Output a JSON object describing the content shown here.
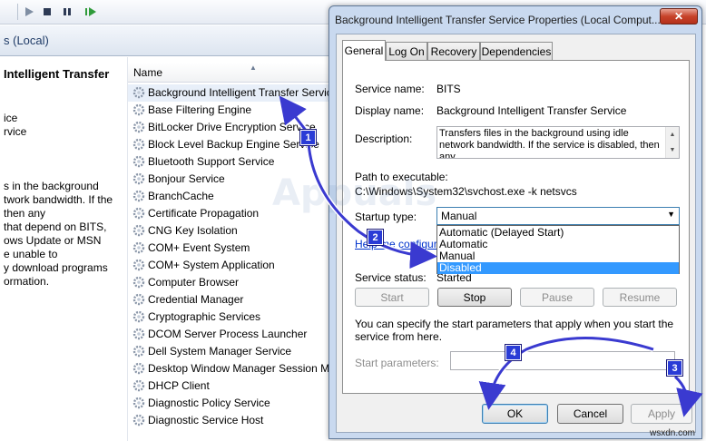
{
  "console": {
    "header_title": "s (Local)",
    "left_pane": {
      "title": "Intelligent Transfer",
      "lines": [
        "ice",
        "rvice",
        "",
        "s in the background",
        "twork bandwidth. If the",
        "then any",
        "that depend on BITS,",
        "ows Update or MSN",
        "e unable to",
        "y download programs",
        "ormation."
      ]
    },
    "column_header": "Name",
    "services": [
      "Background Intelligent Transfer Service",
      "Base Filtering Engine",
      "BitLocker Drive Encryption Service",
      "Block Level Backup Engine Service",
      "Bluetooth Support Service",
      "Bonjour Service",
      "BranchCache",
      "Certificate Propagation",
      "CNG Key Isolation",
      "COM+ Event System",
      "COM+ System Application",
      "Computer Browser",
      "Credential Manager",
      "Cryptographic Services",
      "DCOM Server Process Launcher",
      "Dell System Manager Service",
      "Desktop Window Manager Session Manager",
      "DHCP Client",
      "Diagnostic Policy Service",
      "Diagnostic Service Host"
    ]
  },
  "dialog": {
    "title": "Background Intelligent Transfer Service Properties (Local Comput...",
    "tabs": [
      "General",
      "Log On",
      "Recovery",
      "Dependencies"
    ],
    "service_name_label": "Service name:",
    "service_name": "BITS",
    "display_name_label": "Display name:",
    "display_name": "Background Intelligent Transfer Service",
    "description_label": "Description:",
    "description": "Transfers files in the background using idle network bandwidth. If the service is disabled, then any",
    "path_label": "Path to executable:",
    "path": "C:\\Windows\\System32\\svchost.exe -k netsvcs",
    "startup_label": "Startup type:",
    "startup_value": "Manual",
    "startup_options": [
      "Automatic (Delayed Start)",
      "Automatic",
      "Manual",
      "Disabled"
    ],
    "startup_highlighted": "Disabled",
    "help_link": "Help me configure",
    "status_label": "Service status:",
    "status_value": "Started",
    "buttons": {
      "start": "Start",
      "stop": "Stop",
      "pause": "Pause",
      "resume": "Resume"
    },
    "params_hint": "You can specify the start parameters that apply when you start the service from here.",
    "params_label": "Start parameters:",
    "footer": {
      "ok": "OK",
      "cancel": "Cancel",
      "apply": "Apply"
    }
  },
  "annotations": [
    "1",
    "2",
    "3",
    "4"
  ],
  "watermark": "Appuals",
  "site_mark": "wsxdn.com",
  "colors": {
    "badge": "#2a3cd6",
    "arrow": "#3a3ad0",
    "selection": "#3399ff"
  }
}
